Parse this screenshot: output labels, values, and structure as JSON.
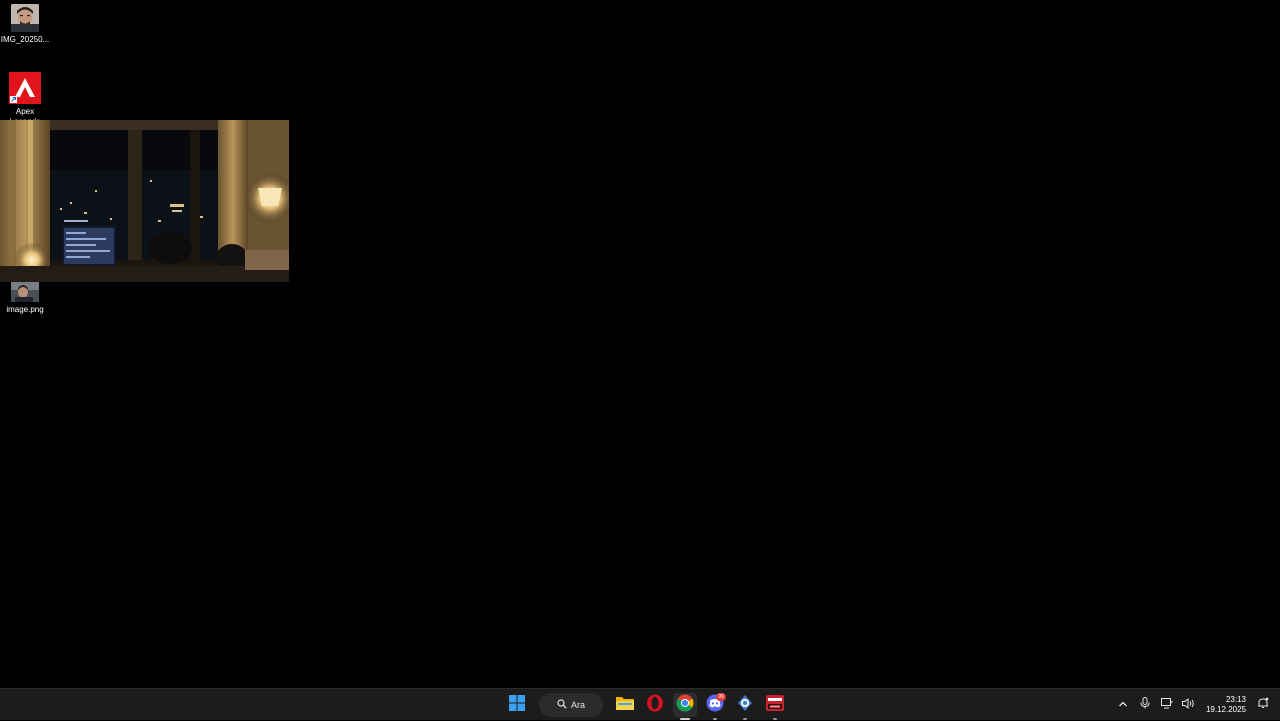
{
  "desktop": {
    "icons": [
      {
        "label": "IMG_20250...",
        "icon": "photo-portrait-icon"
      },
      {
        "label": "Apex\nLegends",
        "icon": "apex-legends-icon"
      },
      {
        "label": "image.png",
        "icon": "image-file-icon"
      }
    ],
    "preview": {
      "icon": "room-night-photo"
    }
  },
  "taskbar": {
    "start_icon": "windows-start-icon",
    "search_label": "Ara",
    "apps": [
      {
        "name": "file-explorer",
        "icon": "folder-icon"
      },
      {
        "name": "opera",
        "icon": "opera-icon"
      },
      {
        "name": "chrome",
        "icon": "chrome-icon"
      },
      {
        "name": "discord",
        "icon": "discord-icon",
        "badge": "99"
      },
      {
        "name": "steam-like",
        "icon": "gear-app-icon"
      },
      {
        "name": "game-app",
        "icon": "game-app-icon"
      }
    ],
    "tray": {
      "time": "23:13",
      "date": "19.12.2025"
    },
    "colors": {
      "taskbar": "#1c1c1c",
      "accent": "#3aa0f0"
    }
  }
}
